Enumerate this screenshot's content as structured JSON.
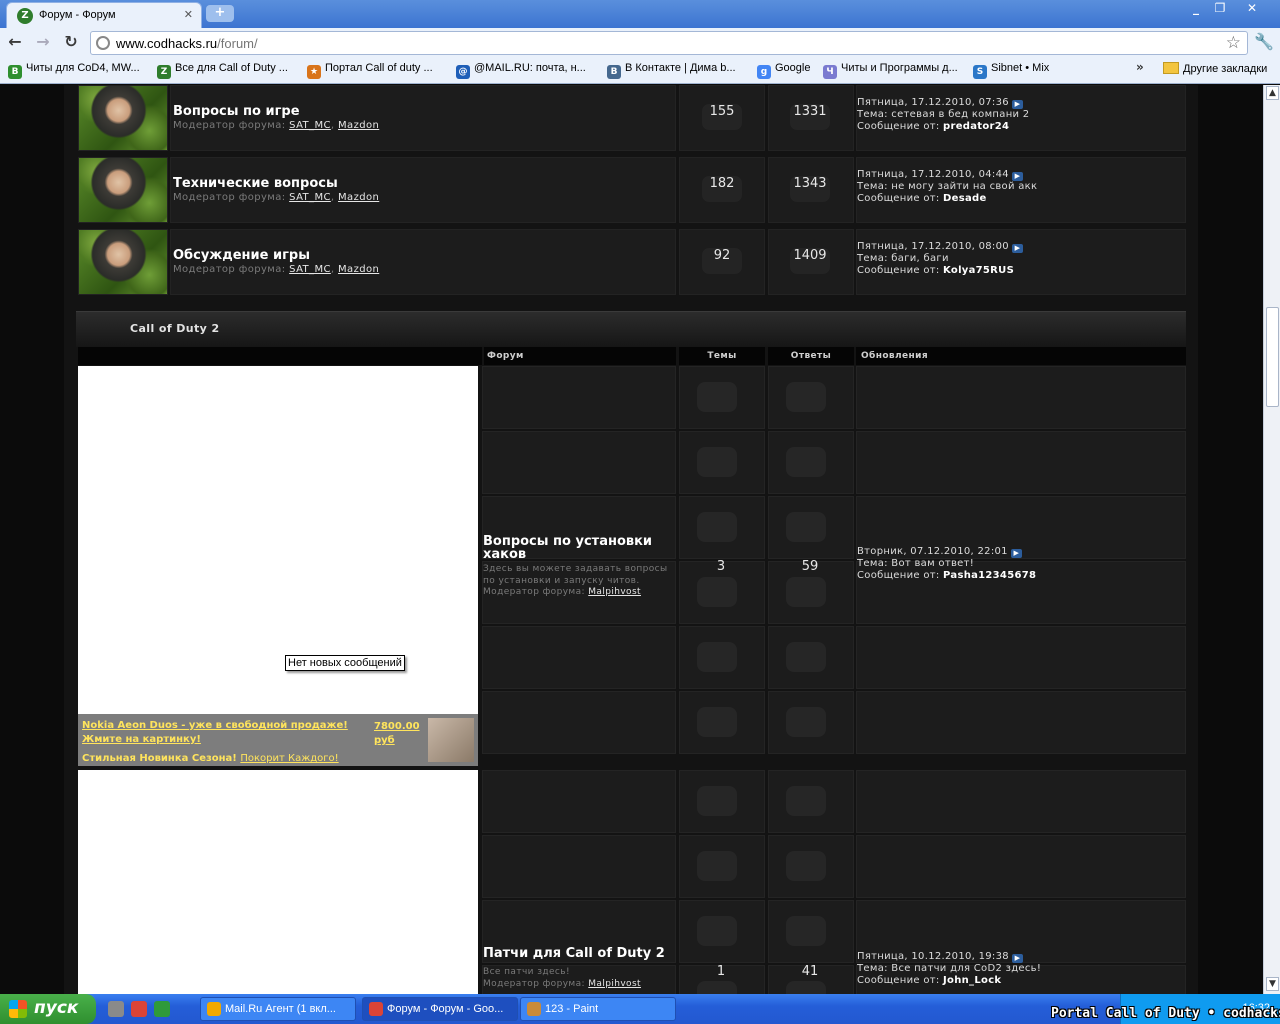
{
  "browser": {
    "tab_title": "Форум - Форум",
    "new_tab": "+",
    "url_host": "www.codhacks.ru",
    "url_path": "/forum/",
    "bookmarks": [
      {
        "label": "Читы для CoD4, MW...",
        "icon_color": "#2f8f2f",
        "icon": "B"
      },
      {
        "label": "Все для Call of Duty ...",
        "icon_color": "#2f7d2c",
        "icon": "Z"
      },
      {
        "label": "Портал Call of duty ...",
        "icon_color": "#d9741a",
        "icon": "★"
      },
      {
        "label": "@MAIL.RU: почта, н...",
        "icon_color": "#1f5fb8",
        "icon": "@"
      },
      {
        "label": "В Контакте | Дима b...",
        "icon_color": "#45688e",
        "icon": "В"
      },
      {
        "label": "Google",
        "icon_color": "#4285f4",
        "icon": "g"
      },
      {
        "label": "Читы и Программы д...",
        "icon_color": "#7a7ad0",
        "icon": "Ч"
      },
      {
        "label": "Sibnet • Mix",
        "icon_color": "#2b77c8",
        "icon": "S"
      }
    ],
    "more_bookmarks": "»",
    "other_bookmarks": "Другие закладки"
  },
  "forum": {
    "moderator_label": "Модератор форума:",
    "rows": [
      {
        "name": "Вопросы по игре",
        "mods": [
          "SAT_MC",
          "Mazdon"
        ],
        "topics": "155",
        "replies": "1331",
        "date": "Пятница, 17.12.2010, 07:36",
        "topic": "сетевая в бед компани 2",
        "author": "predator24"
      },
      {
        "name": "Технические вопросы",
        "mods": [
          "SAT_MC",
          "Mazdon"
        ],
        "topics": "182",
        "replies": "1343",
        "date": "Пятница, 17.12.2010, 04:44",
        "topic": "не могу зайти на свой акк",
        "author": "Desade"
      },
      {
        "name": "Обсуждение игры",
        "mods": [
          "SAT_MC",
          "Mazdon"
        ],
        "topics": "92",
        "replies": "1409",
        "date": "Пятница, 17.12.2010, 08:00",
        "topic": "баги, баги",
        "author": "Kolya75RUS"
      }
    ],
    "topic_prefix": "Тема:",
    "author_prefix": "Сообщение от:",
    "category": "Call of Duty 2",
    "columns": {
      "forum": "Форум",
      "topics": "Темы",
      "replies": "Ответы",
      "updates": "Обновления"
    },
    "cod2": [
      {
        "name": "Вопросы по установки хаков",
        "desc": "Здесь вы можете задавать вопросы по установки и запуску читов.",
        "mod": "Malpihvost",
        "topics": "3",
        "replies": "59",
        "date": "Вторник, 07.12.2010, 22:01",
        "topic": "Вот вам ответ!",
        "author": "Pasha12345678"
      },
      {
        "name": "Патчи для Call of Duty 2",
        "desc": "Все патчи здесь!",
        "mod": "Malpihvost",
        "topics": "1",
        "replies": "41",
        "date": "Пятница, 10.12.2010, 19:38",
        "topic": "Все патчи для CoD2 здесь!",
        "author": "John_Lock"
      }
    ]
  },
  "ad": {
    "line1": "Nokia Aeon Duos - уже в свободной продаже!",
    "line2": "Жмите на картинку!",
    "line3_bold": "Стильная Новинка Сезона!",
    "line3_link": "Покорит Каждого!",
    "price": "7800.00",
    "currency": "руб"
  },
  "tooltip": "Нет новых сообщений",
  "taskbar": {
    "start": "пуск",
    "tasks": [
      {
        "label": "Mail.Ru Агент (1 вкл...",
        "icon_color": "#f2a900"
      },
      {
        "label": "Форум - Форум - Goo...",
        "icon_color": "#db4437"
      },
      {
        "label": "123 - Paint",
        "icon_color": "#c98b3a"
      }
    ],
    "clock": "16:32",
    "overlay": "Portal Call of Duty • codhacks.ru"
  }
}
